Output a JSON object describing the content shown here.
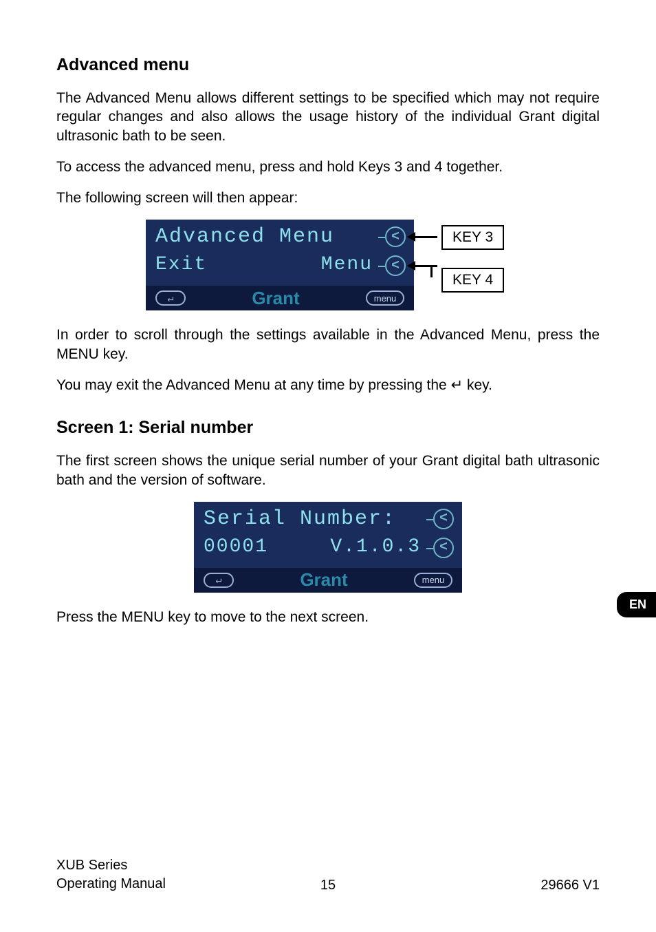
{
  "heading1": "Advanced menu",
  "para1": "The Advanced Menu allows different settings to be specified which may not require regular changes and also allows the usage history of the individual Grant digital ultrasonic bath to be seen.",
  "para2": "To access the advanced menu, press and hold Keys 3 and 4 together.",
  "para3": "The following screen will then appear:",
  "lcd1": {
    "row1": "Advanced Menu",
    "row2_left": "Exit",
    "row2_right": "Menu",
    "brand": "Grant",
    "menu_label": "menu",
    "enter_glyph": "↵",
    "key_top_glyph": "<",
    "key_mid_glyph": "<"
  },
  "callout": {
    "key3": "KEY 3",
    "key4": "KEY 4"
  },
  "para4": "In order to scroll through the settings available in the Advanced Menu, press the MENU key.",
  "para5_pre": "You may exit the Advanced Menu at any time by pressing the ",
  "para5_glyph": "↵",
  "para5_post": " key.",
  "heading2": "Screen 1: Serial number",
  "para6": "The first screen shows the unique serial number of your Grant digital bath ultrasonic bath and the version of software.",
  "lcd2": {
    "row1": "Serial Number:",
    "row2_left": "00001",
    "row2_right": "V.1.0.3",
    "brand": "Grant",
    "menu_label": "menu",
    "enter_glyph": "↵",
    "key_top_glyph": "<",
    "key_mid_glyph": "<"
  },
  "para7": "Press the MENU key to move to the next screen.",
  "lang_tab": "EN",
  "footer": {
    "series": "XUB Series",
    "manual": "Operating Manual",
    "page": "15",
    "doc": "29666 V1"
  }
}
